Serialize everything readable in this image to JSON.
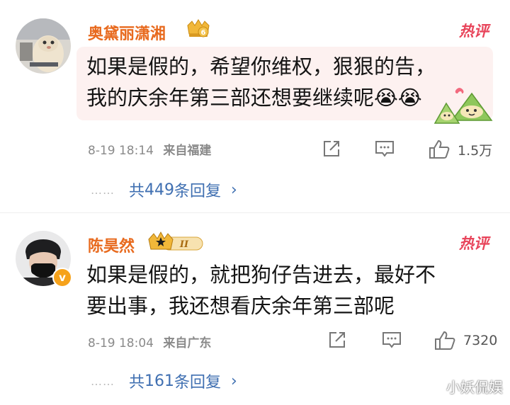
{
  "comments": [
    {
      "username": "奥黛丽潇湘",
      "hot_label": "热评",
      "text_line1": "如果是假的，希望你维权，狠狠的告，",
      "text_line2": "我的庆余年第三部还想要继续呢😭😭",
      "level_number": "6",
      "date": "8-19 18:14",
      "location": "来自福建",
      "likes": "1.5万",
      "reply_prefix": "共",
      "reply_count": "449",
      "reply_suffix": "条回复"
    },
    {
      "username": "陈昊然",
      "hot_label": "热评",
      "text_line1": "如果是假的，就把狗仔告进去，最好不",
      "text_line2": "要出事，我还想看庆余年第三部呢",
      "level_roman": "II",
      "date": "8-19 18:04",
      "location": "来自广东",
      "likes": "7320",
      "reply_prefix": "共",
      "reply_count": "161",
      "reply_suffix": "条回复"
    }
  ],
  "reply_dots": "……",
  "watermark": "小妖侃娱",
  "colors": {
    "username": "#e86a1e",
    "hot": "#e8445a",
    "link": "#3f6fb1",
    "meta": "#8a8a8a"
  },
  "icons": [
    "share-icon",
    "comment-icon",
    "like-icon",
    "chevron-right-icon",
    "verified-badge-icon",
    "crown-level-icon"
  ]
}
